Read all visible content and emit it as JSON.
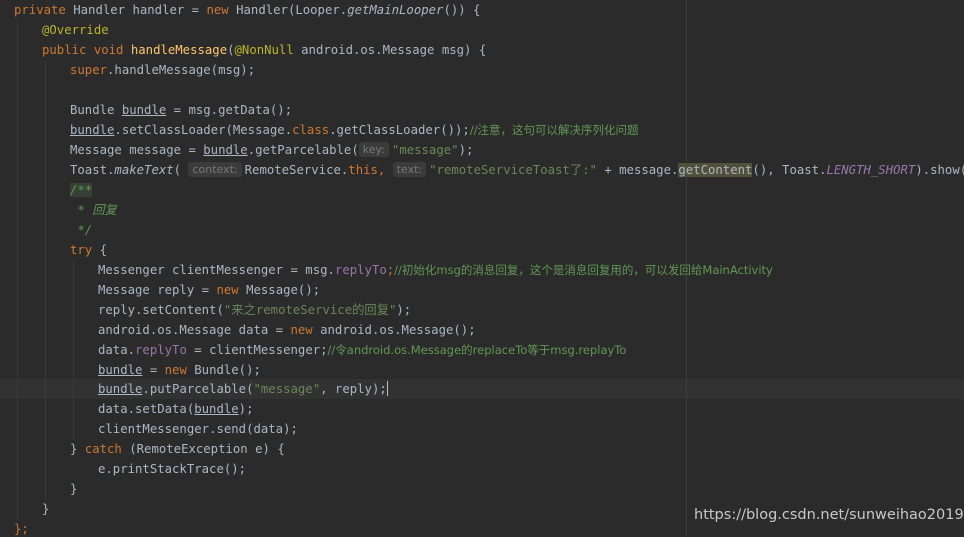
{
  "code": {
    "l1_private": "private",
    "l1_type": " Handler handler = ",
    "l1_new": "new",
    "l1_ctor": " Handler(Looper.",
    "l1_method": "getMainLooper",
    "l1_end": "()) {",
    "l2_annotation": "@Override",
    "l3_public": "public",
    "l3_void": "void",
    "l3_name": "handleMessage",
    "l3_paren": "(",
    "l3_nonnull": "@NonNull",
    "l3_params": " android.os.Message msg) {",
    "l4_super": "super",
    "l4_call": ".handleMessage(msg);",
    "l6_pre": "Bundle ",
    "l6_var": "bundle",
    "l6_post": " = msg.getData();",
    "l7_var": "bundle",
    "l7_mid": ".setClassLoader(Message.",
    "l7_class": "class",
    "l7_post": ".getClassLoader());",
    "l7_comment": "//注意，这句可以解决序列化问题",
    "l8_pre": "Message message = ",
    "l8_var": "bundle",
    "l8_mid": ".getParcelable(",
    "l8_hint": "key:",
    "l8_str": "\"message\"",
    "l8_end": ");",
    "l9_pre": "Toast.",
    "l9_method": "makeText",
    "l9_paren": "(",
    "l9_hint_context": "context:",
    "l9_remote": "RemoteService.",
    "l9_this": "this",
    "l9_comma": ",",
    "l9_hint_text": "text:",
    "l9_str": "\"remoteServiceToast了:\"",
    "l9_plus": " + message.",
    "l9_getcontent": "getContent",
    "l9_mid": "(), Toast.",
    "l9_const": "LENGTH_SHORT",
    "l9_end": ").show();",
    "l10_doc": "/**",
    "l11_doc": " * 回复",
    "l12_doc": " */",
    "l13_try": "try",
    "l13_brace": " {",
    "l14_pre": "Messenger clientMessenger = msg.",
    "l14_field": "replyTo",
    "l14_semi": ";",
    "l14_comment": "//初始化msg的消息回复，这个是消息回复用的，可以发回给MainActivity",
    "l15_pre": "Message reply = ",
    "l15_new": "new",
    "l15_post": " Message();",
    "l16_pre": "reply.setContent(",
    "l16_str": "\"来之remoteService的回复\"",
    "l16_end": ");",
    "l17_pre": "android.os.Message data = ",
    "l17_new": "new",
    "l17_post": " android.os.Message();",
    "l18_pre": "data.",
    "l18_field": "replyTo",
    "l18_mid": " = clientMessenger;",
    "l18_comment": "//令android.os.Message的replaceTo等于msg.replayTo",
    "l19_var": "bundle",
    "l19_eq": " = ",
    "l19_new": "new",
    "l19_post": " Bundle();",
    "l20_var": "bundle",
    "l20_mid": ".putParcelable(",
    "l20_str": "\"message\"",
    "l20_post": ", reply);",
    "l21_pre": "data.setData(",
    "l21_var": "bundle",
    "l21_end": ");",
    "l22_text": "clientMessenger.send(data);",
    "l23_close": "} ",
    "l23_catch": "catch",
    "l23_post": " (RemoteException e) {",
    "l24_text": "e.printStackTrace();",
    "l25_text": "}",
    "l26_text": "}",
    "l27_text": "};"
  },
  "watermark": "https://blog.csdn.net/sunweihao2019",
  "colors": {
    "background": "#2b2b2b",
    "keyword": "#cc7832",
    "method_decl": "#ffc66d",
    "string": "#6a8759",
    "comment": "#629755",
    "annotation": "#bbb529",
    "field": "#9876aa",
    "default_text": "#a9b7c6"
  }
}
